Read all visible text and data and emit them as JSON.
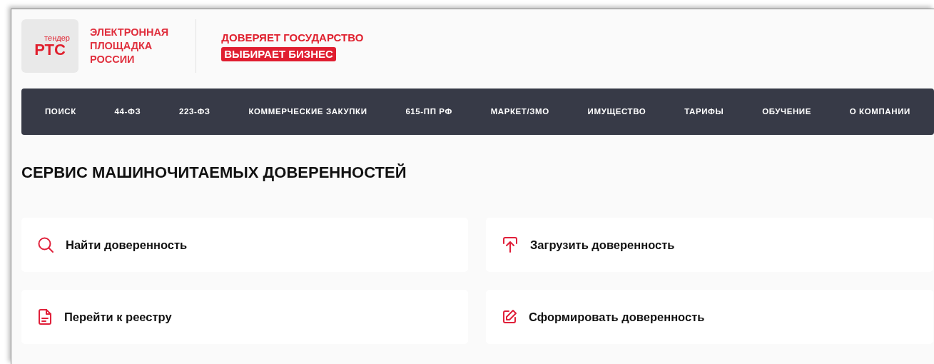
{
  "logo": {
    "small": "тендер",
    "big": "РТС"
  },
  "site_name": [
    "ЭЛЕКТРОННАЯ",
    "ПЛОЩАДКА",
    "РОССИИ"
  ],
  "slogan": {
    "line1": "ДОВЕРЯЕТ ГОСУДАРСТВО",
    "line2": "ВЫБИРАЕТ БИЗНЕС"
  },
  "nav": [
    "ПОИСК",
    "44-ФЗ",
    "223-ФЗ",
    "КОММЕРЧЕСКИЕ ЗАКУПКИ",
    "615-ПП РФ",
    "МАРКЕТ/ЗМО",
    "ИМУЩЕСТВО",
    "ТАРИФЫ",
    "ОБУЧЕНИЕ",
    "О КОМПАНИИ"
  ],
  "heading": "СЕРВИС МАШИНОЧИТАЕМЫХ ДОВЕРЕННОСТЕЙ",
  "actions": [
    {
      "label": "Найти доверенность",
      "kind": "search"
    },
    {
      "label": "Загрузить доверенность",
      "kind": "upload"
    },
    {
      "label": "Перейти к реестру",
      "kind": "document"
    },
    {
      "label": "Сформировать доверенность",
      "kind": "edit"
    }
  ]
}
